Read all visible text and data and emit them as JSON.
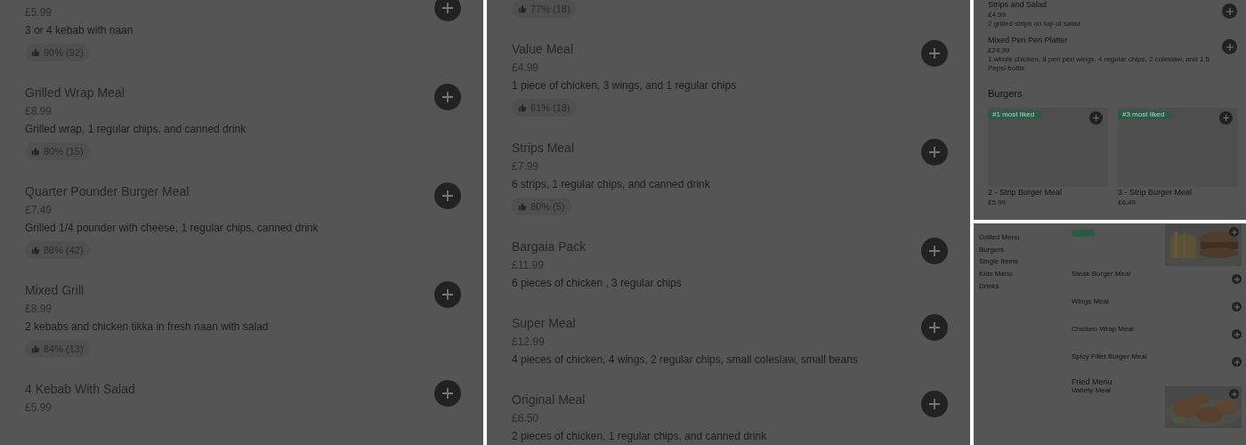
{
  "left_list": {
    "items": [
      {
        "price": "£5.99",
        "description": "3 or 4 kebab with naan",
        "rating": "90% (92)"
      },
      {
        "name": "Grilled Wrap Meal",
        "price": "£8.99",
        "description": "Grilled wrap, 1 regular chips, and canned drink",
        "rating": "80% (15)"
      },
      {
        "name": "Quarter Pounder Burger Meal",
        "price": "£7.49",
        "description": "Grilled 1/4 pounder with cheese, 1 regular chips, canned drink",
        "rating": "88% (42)"
      },
      {
        "name": "Mixed Grill",
        "price": "£8.99",
        "description": "2 kebabs and chicken tikka in fresh naan with salad",
        "rating": "84% (13)"
      },
      {
        "name": "4 Kebab With Salad",
        "price": "£5.99"
      }
    ]
  },
  "middle_list": {
    "items": [
      {
        "rating": "77% (18)"
      },
      {
        "name": "Value Meal",
        "price": "£4.99",
        "description": "1 piece of chicken, 3 wings, and 1 regular chips",
        "rating": "61% (18)"
      },
      {
        "name": "Strips Meal",
        "price": "£7.99",
        "description": "6 strips, 1 regular chips, and canned drink",
        "rating": "80% (5)"
      },
      {
        "name": "Bargaia Pack",
        "price": "£11.99",
        "description": "6 pieces of chicken , 3 regular chips"
      },
      {
        "name": "Super Meal",
        "price": "£12.99",
        "description": "4 pieces of chicken, 4 wings, 2 regular chips, small coleslaw, small beans"
      },
      {
        "name": "Original Meal",
        "price": "£6.50",
        "description": "2 pieces of chicken, 1 regular chips, and canned drink"
      }
    ]
  },
  "top_right": {
    "items": [
      {
        "name": "Strips and Salad",
        "price": "£4.99",
        "description": "2 grilled strips on top of salad"
      },
      {
        "name": "Mixed Peri Peri Platter",
        "price": "£24.99",
        "description": "1 whole chicken, 8 peri peri wings, 4 regular chips, 2 coleslaw, and 1.5 Pepsi bottle"
      }
    ],
    "section": {
      "title": "Burgers",
      "cards": [
        {
          "badge": "#1 most liked",
          "name": "2 - Strip Burger Meal",
          "price": "£5.99"
        },
        {
          "badge": "#3 most liked",
          "name": "3 - Strip Burger Meal",
          "price": "£6.49"
        }
      ]
    }
  },
  "bottom_right": {
    "sidebar": [
      {
        "label": "Grilled Menu"
      },
      {
        "label": "Burgers"
      },
      {
        "label": "Single Items"
      },
      {
        "label": "Kids Menu"
      },
      {
        "label": "Drinks"
      }
    ],
    "items": [
      {
        "tag": true,
        "kind": "picture"
      },
      {
        "name": "Steak Burger Meal",
        "tag": false
      },
      {
        "name": "Wings Meal",
        "tag": false
      },
      {
        "name": "Chicken Wrap Meal",
        "tag": false
      },
      {
        "name": "Spicy Fillet Burger Meal",
        "tag": false
      }
    ],
    "section": {
      "title": "Fried Menu",
      "items": [
        {
          "name": "Variety Meal",
          "kind": "picture",
          "tag": false
        }
      ]
    }
  }
}
